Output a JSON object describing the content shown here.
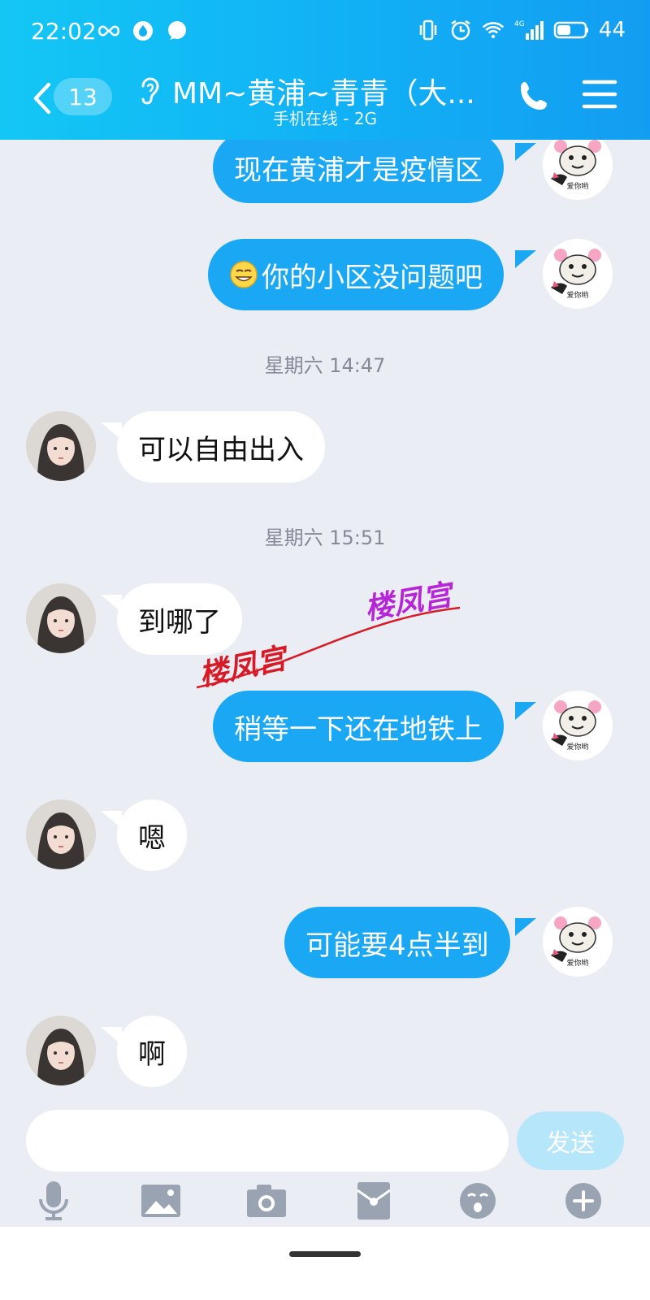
{
  "status_bar": {
    "time": "22:02",
    "battery": "44",
    "network": "4G"
  },
  "header": {
    "unread_count": "13",
    "title": "MM~黄浦~青青（大...",
    "subtitle": "手机在线 - 2G"
  },
  "messages": [
    {
      "side": "out",
      "text": "现在黄浦才是疫情区"
    },
    {
      "side": "out",
      "text": "你的小区没问题吧",
      "emoji": "grinning-face-icon"
    },
    {
      "side": "in",
      "text": "可以自由出入"
    },
    {
      "side": "in",
      "text": "到哪了"
    },
    {
      "side": "out",
      "text": "稍等一下还在地铁上"
    },
    {
      "side": "in",
      "text": "嗯"
    },
    {
      "side": "out",
      "text": "可能要4点半到"
    },
    {
      "side": "in",
      "text": "啊"
    }
  ],
  "timestamps": [
    "星期六 14:47",
    "星期六 15:51"
  ],
  "avatar_caption": "爱你哟",
  "watermark": {
    "text1": "楼凤宫",
    "text2": "楼凤宫"
  },
  "input": {
    "placeholder": "",
    "send_label": "发送"
  },
  "toolbar_icons": [
    "microphone-icon",
    "image-icon",
    "camera-icon",
    "red-packet-icon",
    "emoji-icon",
    "plus-icon"
  ],
  "colors": {
    "header": "#11b0f5",
    "outgoing_bubble": "#1aa8f5",
    "background": "#ebedf5",
    "send_button": "#b5e6fa"
  }
}
